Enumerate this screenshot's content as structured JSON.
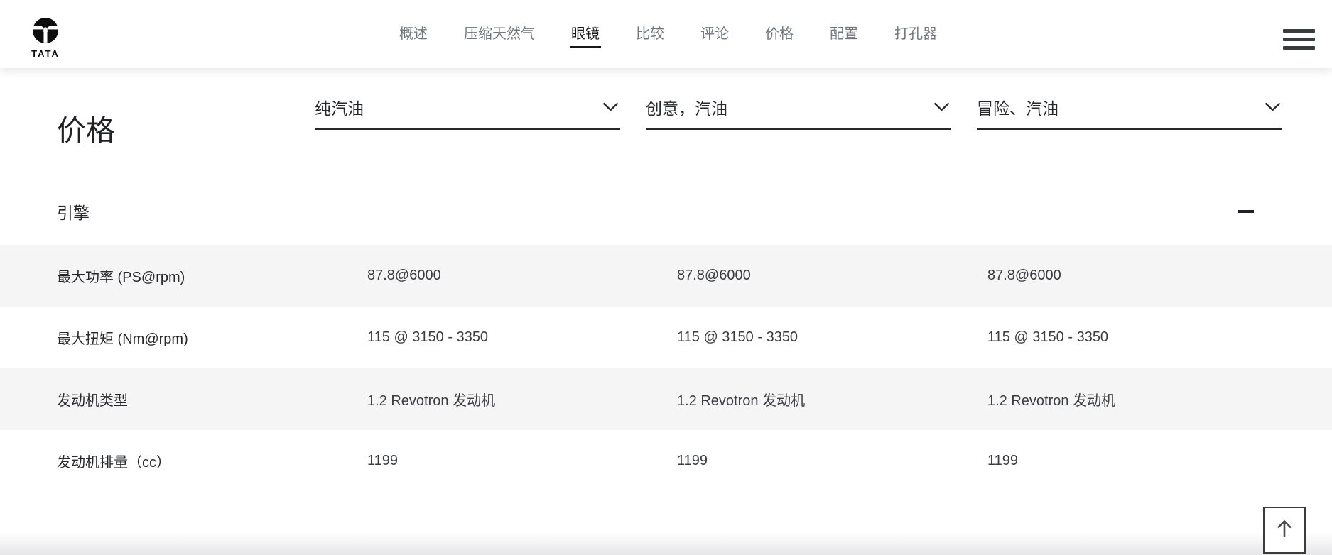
{
  "brand": {
    "logo_text": "TATA",
    "logo_icon": "tata-roundel"
  },
  "nav": {
    "items": [
      {
        "label": "概述",
        "active": false
      },
      {
        "label": "压缩天然气",
        "active": false
      },
      {
        "label": "眼镜",
        "active": true
      },
      {
        "label": "比较",
        "active": false
      },
      {
        "label": "评论",
        "active": false
      },
      {
        "label": "价格",
        "active": false
      },
      {
        "label": "配置",
        "active": false
      },
      {
        "label": "打孔器",
        "active": false
      }
    ]
  },
  "page": {
    "title": "价格"
  },
  "selectors": [
    {
      "value": "纯汽油"
    },
    {
      "value": "创意，汽油"
    },
    {
      "value": "冒险、汽油"
    }
  ],
  "section": {
    "title": "引擎"
  },
  "spec_table": {
    "rows": [
      {
        "label": "最大功率 (PS@rpm)",
        "values": [
          "87.8@6000",
          "87.8@6000",
          "87.8@6000"
        ]
      },
      {
        "label": "最大扭矩 (Nm@rpm)",
        "values": [
          "115 @ 3150 - 3350",
          "115 @ 3150 - 3350",
          "115 @ 3150 - 3350"
        ]
      },
      {
        "label": "发动机类型",
        "values": [
          "1.2 Revotron 发动机",
          "1.2 Revotron 发动机",
          "1.2 Revotron 发动机"
        ]
      },
      {
        "label": "发动机排量（cc）",
        "values": [
          "1199",
          "1199",
          "1199"
        ]
      }
    ]
  },
  "colors": {
    "accent_dark": "#17191c",
    "nav_inactive": "#72767d",
    "row_stripe": "#f5f5f6",
    "text_primary": "#26282c"
  }
}
